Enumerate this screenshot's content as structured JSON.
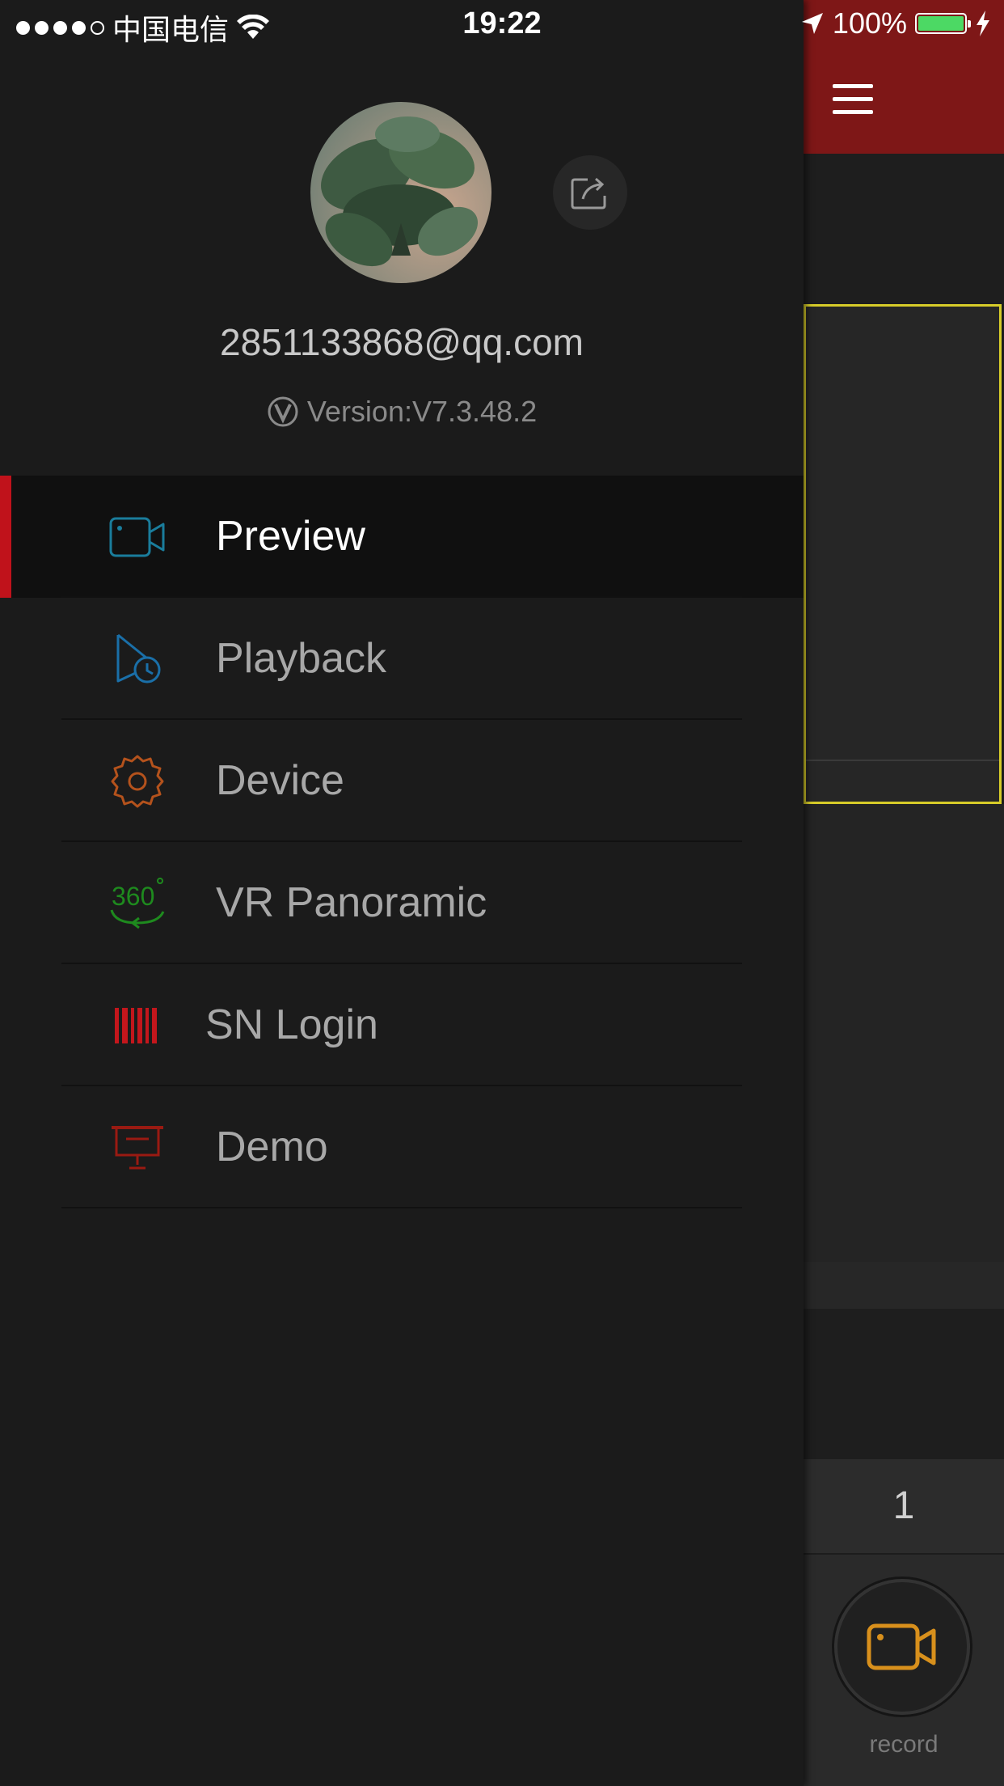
{
  "status_bar": {
    "carrier": "中国电信",
    "time": "19:22",
    "battery": "100%",
    "battery_level": 1.0
  },
  "background_app": {
    "page_number": "1",
    "record_label": "record"
  },
  "drawer": {
    "email": "2851133868@qq.com",
    "version": "Version:V7.3.48.2",
    "menu": [
      {
        "label": "Preview",
        "icon": "video-camera-icon",
        "color": "#1a7d9c",
        "active": true
      },
      {
        "label": "Playback",
        "icon": "playback-clock-icon",
        "color": "#1a6fa8",
        "active": false
      },
      {
        "label": "Device",
        "icon": "gear-icon",
        "color": "#b4521c",
        "active": false
      },
      {
        "label": "VR Panoramic",
        "icon": "vr-360-icon",
        "icon_text": "360",
        "color": "#1e8a1e",
        "active": false
      },
      {
        "label": "SN Login",
        "icon": "barcode-icon",
        "color": "#c4161c",
        "active": false
      },
      {
        "label": "Demo",
        "icon": "presentation-screen-icon",
        "color": "#9a1a12",
        "active": false
      }
    ]
  },
  "colors": {
    "accent_red": "#c0121b",
    "header_red": "#7e1717",
    "selection_yellow": "#d7cc29",
    "record_orange": "#d8901c"
  }
}
